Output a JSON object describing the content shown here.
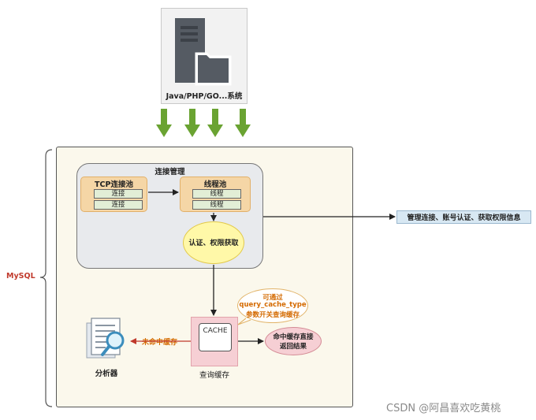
{
  "client": {
    "label": "Java/PHP/GO...系统",
    "icon": "server-icon"
  },
  "mysql": {
    "label": "MySQL"
  },
  "connection_management": {
    "title": "连接管理",
    "tcp_pool": {
      "title": "TCP连接池",
      "slots": [
        "连接",
        "连接"
      ]
    },
    "thread_pool": {
      "title": "线程池",
      "slots": [
        "线程",
        "线程"
      ]
    },
    "auth": {
      "label": "认证、权限获取"
    }
  },
  "connection_summary": {
    "label": "管理连接、账号认证、获取权限信息"
  },
  "query_cache": {
    "inner_label": "CACHE",
    "caption": "查询缓存",
    "note": [
      "可通过",
      "query_cache_type",
      "参数开关查询缓存"
    ],
    "hit": [
      "命中缓存直接",
      "返回结果"
    ],
    "miss": "未命中缓存"
  },
  "analyzer": {
    "caption": "分析器",
    "icon": "magnifier-document-icon"
  },
  "watermark": "CSDN @阿昌喜欢吃黄桃",
  "colors": {
    "arrow_green": "#6aa332",
    "pool_orange": "#f5d6a6",
    "auth_yellow": "#fff8a8",
    "cache_pink": "#f6cfd4",
    "mysql_red": "#c0392b",
    "note_orange": "#d46a00",
    "summary_blue": "#d8e8f3"
  }
}
